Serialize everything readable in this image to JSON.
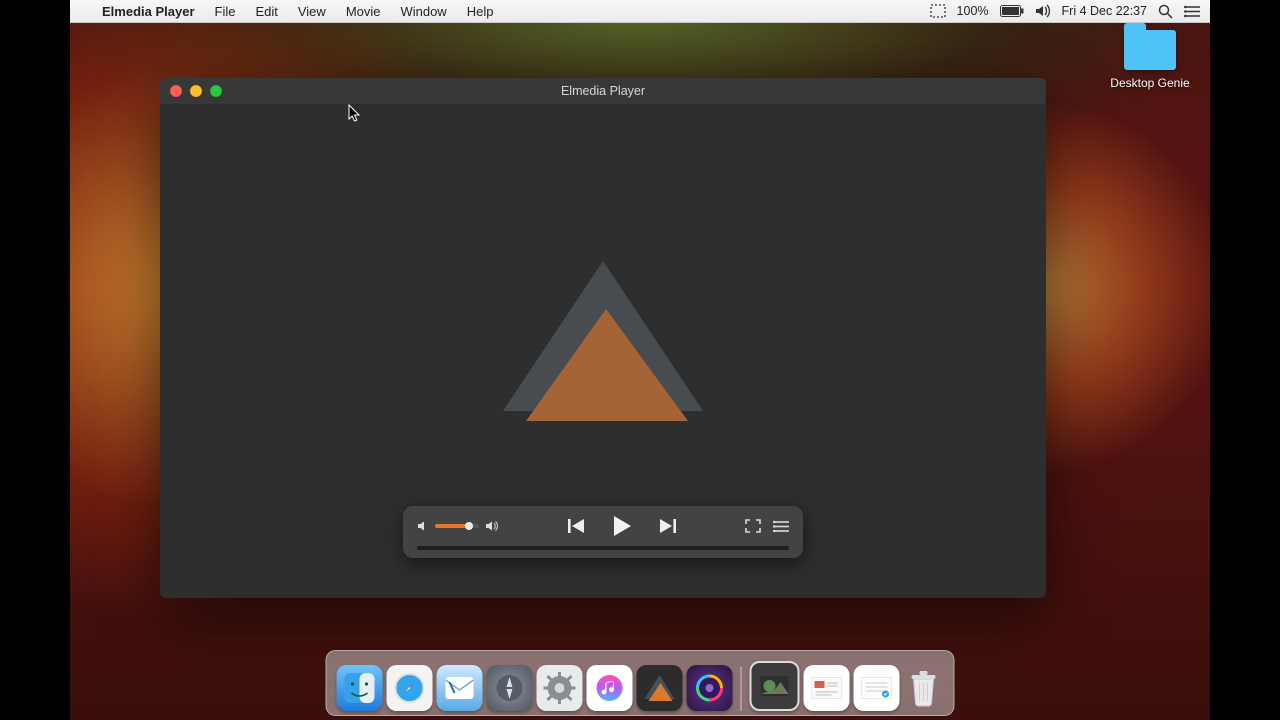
{
  "menubar": {
    "app_name": "Elmedia Player",
    "items": [
      "File",
      "Edit",
      "View",
      "Movie",
      "Window",
      "Help"
    ],
    "battery_pct": "100%",
    "clock": "Fri 4 Dec  22:37"
  },
  "desktop_icon": {
    "label": "Desktop Genie"
  },
  "window": {
    "title": "Elmedia Player",
    "volume_pct": 78,
    "progress_pct": 0
  },
  "dock_items": [
    "Finder",
    "Safari",
    "Mail",
    "Launchpad",
    "System Preferences",
    "iTunes",
    "Elmedia Player",
    "iMovie",
    "Photos",
    "Contacts",
    "Notes"
  ],
  "colors": {
    "accent": "#e8742a"
  }
}
